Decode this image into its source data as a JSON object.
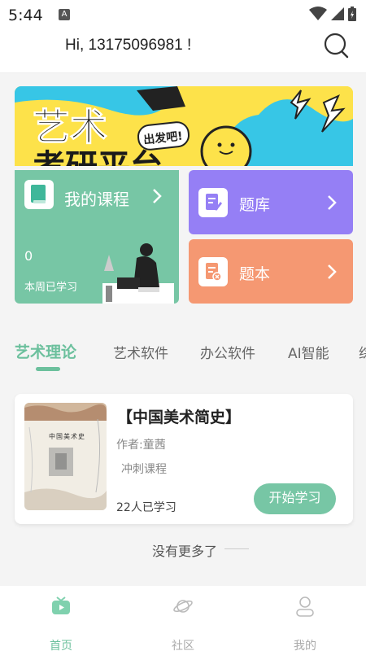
{
  "status": {
    "time": "5:44",
    "indicator": "A"
  },
  "header": {
    "greeting": "Hi, 13175096981 !"
  },
  "banner": {
    "line1": "艺术",
    "line2": "考研平台",
    "sticker": "出发吧!"
  },
  "cards": {
    "courses": {
      "title": "我的课程",
      "count": "0",
      "subtitle": "本周已学习"
    },
    "bank": {
      "title": "题库"
    },
    "notes": {
      "title": "题本"
    }
  },
  "tabs": [
    "艺术理论",
    "艺术软件",
    "办公软件",
    "AI智能",
    "综"
  ],
  "course": {
    "title": "【中国美术简史】",
    "author": "作者:童茜",
    "tag": "冲刺课程",
    "learned": "22人已学习",
    "button": "开始学习",
    "cover_title": "中国美术史"
  },
  "footer": {
    "no_more": "没有更多了"
  },
  "nav": [
    {
      "label": "首页",
      "icon": "tv-icon"
    },
    {
      "label": "社区",
      "icon": "planet-icon"
    },
    {
      "label": "我的",
      "icon": "user-icon"
    }
  ],
  "colors": {
    "accent": "#6cc09d",
    "courses_card": "#77c6a5",
    "bank_card": "#957ff5",
    "notes_card": "#f59872",
    "banner": "#fde24a"
  }
}
